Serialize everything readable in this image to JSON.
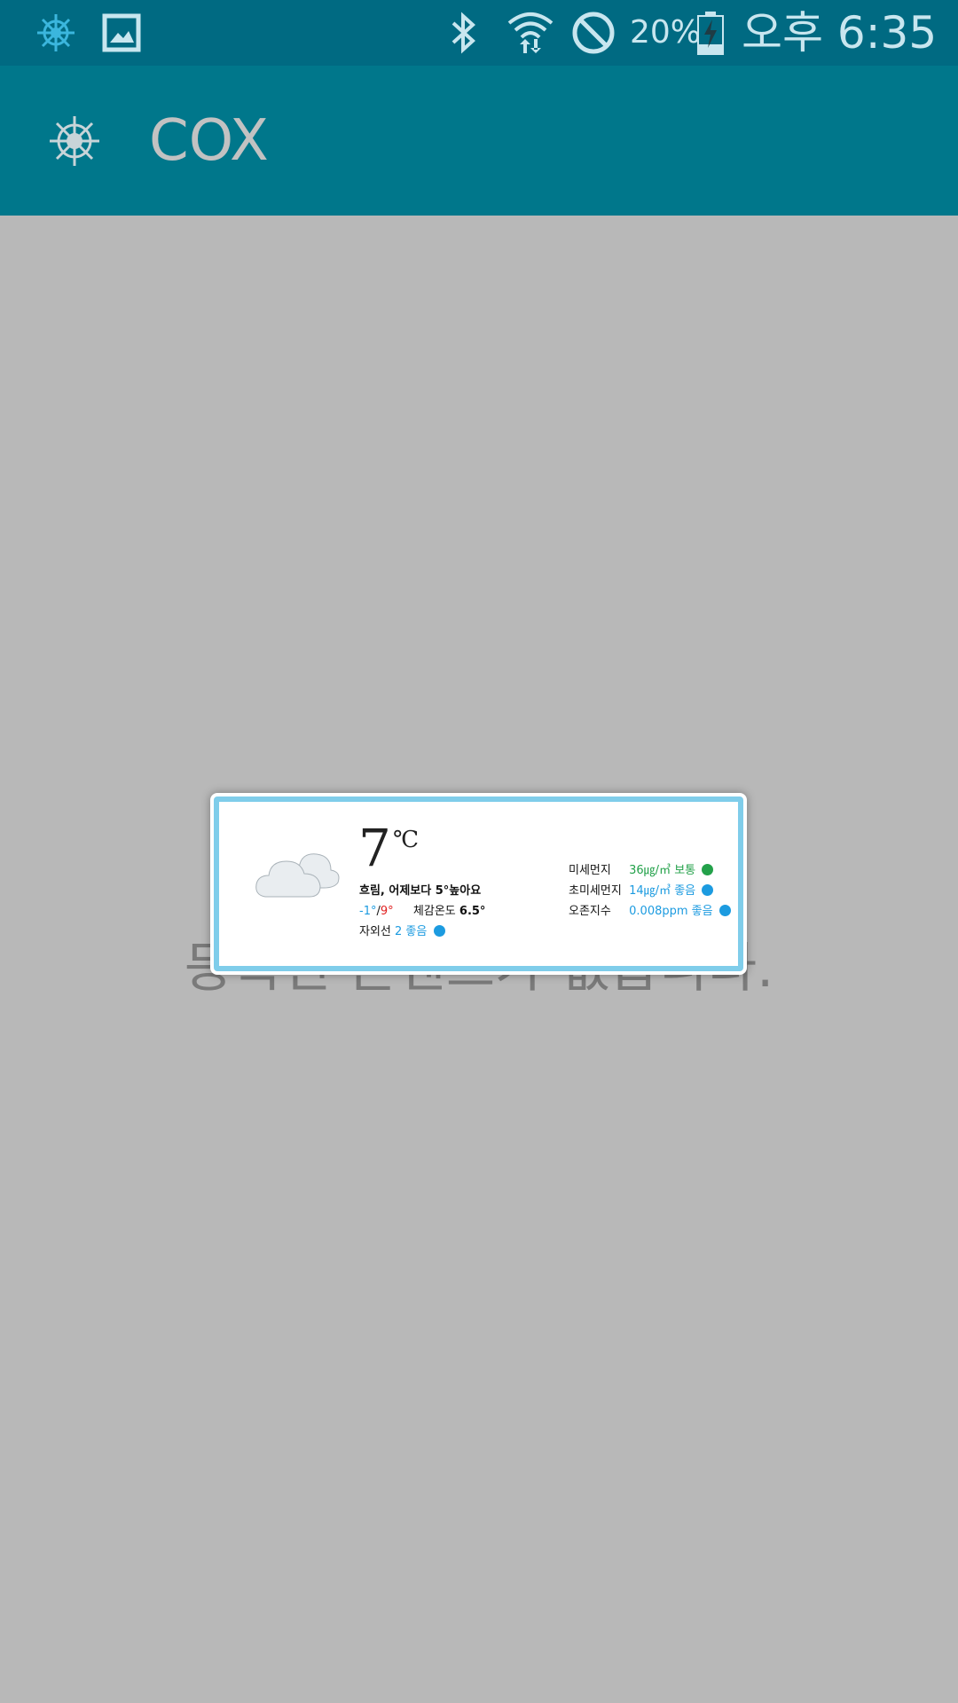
{
  "status_bar": {
    "battery_percent": "20%",
    "time": "오후 6:35",
    "icons": [
      "helm-icon",
      "image-icon",
      "bluetooth-icon",
      "wifi-icon",
      "block-icon",
      "battery-charging-icon"
    ]
  },
  "app_bar": {
    "title": "COX",
    "icon": "helm-icon"
  },
  "background_message": "등록된 콘텐츠가 없습니다.",
  "widget": {
    "temperature": "7",
    "unit": "℃",
    "condition": "흐림, 어제보다 5°높아요",
    "low": "-1°",
    "separator": "/",
    "high": "9°",
    "feels_like_label": "체감온도",
    "feels_like_value": "6.5°",
    "uv_label": "자외선",
    "uv_value": "2 좋음",
    "air_quality": [
      {
        "label": "미세먼지",
        "value": "36㎍/㎥ 보통",
        "color": "#23a14a"
      },
      {
        "label": "초미세먼지",
        "value": "14㎍/㎥ 좋음",
        "color": "#1c9be0"
      },
      {
        "label": "오존지수",
        "value": "0.008ppm 좋음",
        "color": "#1c9be0"
      }
    ]
  },
  "colors": {
    "status_bar": "#006a82",
    "app_bar": "#00778b",
    "background": "#b8b8b8",
    "widget_border": "#7fcdea",
    "good": "#1c9be0",
    "normal": "#23a14a"
  }
}
